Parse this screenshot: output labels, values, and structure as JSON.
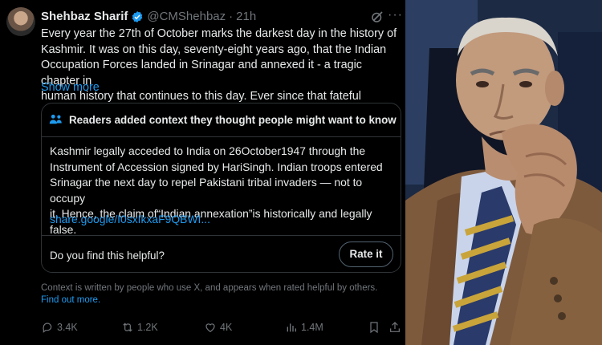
{
  "tweet": {
    "author_name": "Shehbaz Sharif",
    "handle": "@CMShehbaz",
    "separator": "·",
    "time": "21h",
    "more_label": "···",
    "text_lines": [
      "Every year the 27th of October marks the darkest day in the history of",
      "Kashmir. It was on this day, seventy-eight years ago, that the Indian",
      "Occupation Forces landed in Srinagar and annexed it - a tragic chapter in",
      "human history that continues to this day. Ever since that fateful"
    ],
    "show_more": "Show more"
  },
  "community_note": {
    "title": "Readers added context they thought people might want to know",
    "text_lines": [
      "Kashmir legally acceded to India on 26October1947 through the",
      "Instrument of Accession signed by HariSingh. Indian troops entered",
      "Srinagar the next day to repel Pakistani tribal invaders — not to occupy",
      "it. Hence, the claim of“Indian annexation”is historically and legally",
      "false."
    ],
    "link": "share.google/I0sxIkxaF9QBWI...",
    "helpful_question": "Do you find this helpful?",
    "rate_label": "Rate it"
  },
  "context_footer": {
    "text": "Context is written by people who use X, and appears when rated helpful by others.",
    "find_out_more": "Find out more."
  },
  "actions": {
    "replies": "3.4K",
    "reposts": "1.2K",
    "likes": "4K",
    "views": "1.4M"
  },
  "colors": {
    "background": "#000000",
    "text": "#e7e9ea",
    "muted": "#71767b",
    "link": "#1d9bf0",
    "border": "#2f3336",
    "verified": "#1d9bf0"
  },
  "icons": [
    "verified-icon",
    "grok-icon",
    "more-icon",
    "people-icon",
    "reply-icon",
    "repost-icon",
    "like-icon",
    "views-icon",
    "bookmark-icon",
    "share-icon"
  ]
}
